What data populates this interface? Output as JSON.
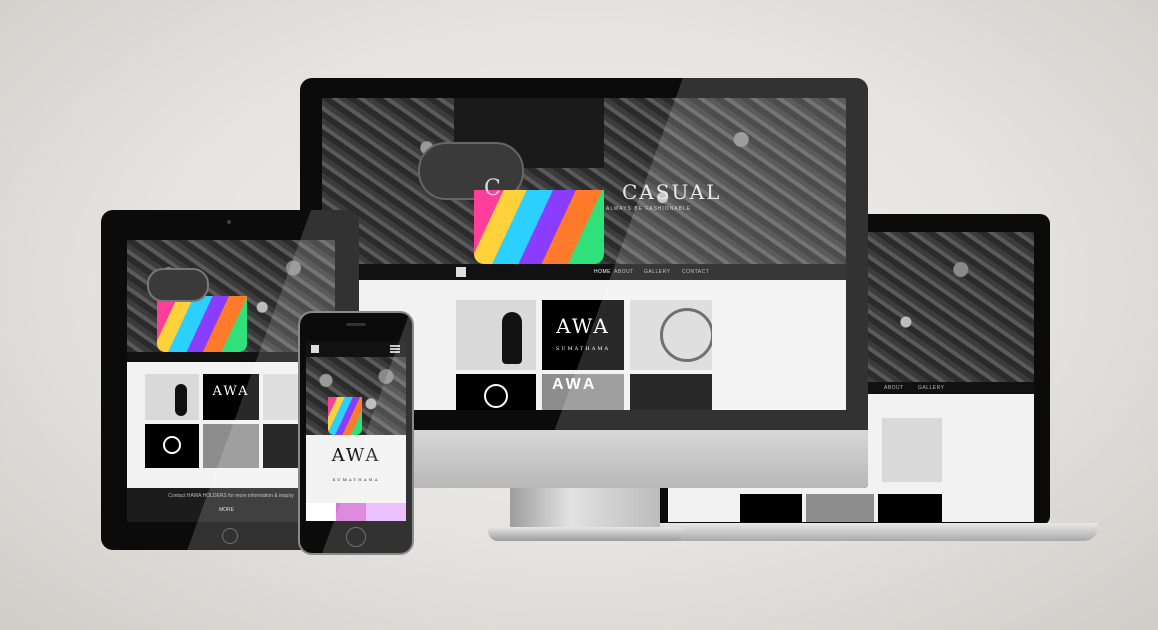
{
  "site": {
    "hero_title_left": "C",
    "hero_title_right": "CASUAL",
    "hero_subtitle": "ALWAYS BE FASHIONABLE",
    "logo_mark": "AWA",
    "logo_word": "SUMATHAMA",
    "nav": [
      "HOME",
      "ABOUT",
      "GALLERY",
      "CONTACT"
    ],
    "tablet_footer_text": "Contact HAWA HOLDERS for more information & inquiry",
    "tablet_footer_link": "MORE",
    "tile_banner": "AWA"
  },
  "colors": {
    "device_frame": "#0b0b0b",
    "silver": "#c9c9c9",
    "page_white": "#f2f2f2"
  }
}
